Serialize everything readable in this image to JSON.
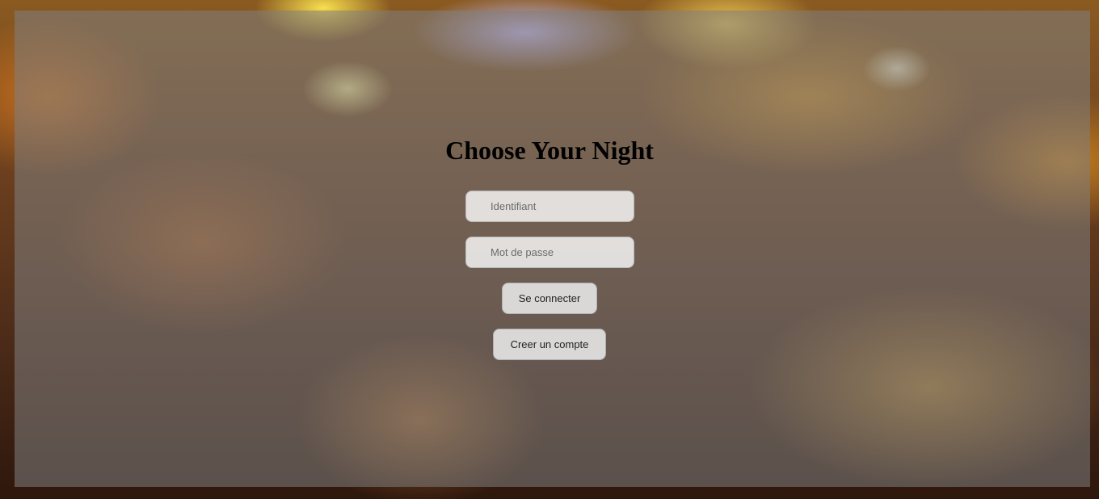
{
  "page": {
    "title": "Choose Your Night"
  },
  "form": {
    "username_placeholder": "Identifiant",
    "password_placeholder": "Mot de passe",
    "login_label": "Se connecter",
    "signup_label": "Creer un compte"
  }
}
